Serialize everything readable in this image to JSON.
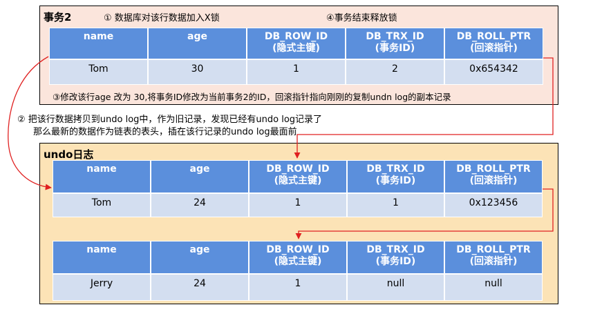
{
  "transaction": {
    "title": "事务2",
    "note_lock": "① 数据库对该行数据加入X锁",
    "note_release": "④事务结束释放锁",
    "note_modify": "③修改该行age 改为 30,将事务ID修改为当前事务2的ID，回滚指针指向刚刚的复制undn log的副本记录",
    "table": {
      "headers": [
        "name",
        "age",
        "DB_ROW_ID\n(隐式主键)",
        "DB_TRX_ID\n(事务ID)",
        "DB_ROLL_PTR\n(回滚指针)"
      ],
      "row": [
        "Tom",
        "30",
        "1",
        "2",
        "0x654342"
      ]
    }
  },
  "copy_note": {
    "line1": "② 把该行数据拷贝到undo log中，作为旧记录，发现已经有undo log记录了",
    "line2": "那么最新的数据作为链表的表头，插在该行记录的undo log最面前"
  },
  "undo_log": {
    "title": "undo日志",
    "record1": {
      "headers": [
        "name",
        "age",
        "DB_ROW_ID\n(隐式主键)",
        "DB_TRX_ID\n(事务ID)",
        "DB_ROLL_PTR\n(回滚指针)"
      ],
      "row": [
        "Tom",
        "24",
        "1",
        "1",
        "0x123456"
      ]
    },
    "record2": {
      "headers": [
        "name",
        "age",
        "DB_ROW_ID\n(隐式主键)",
        "DB_TRX_ID\n(事务ID)",
        "DB_ROLL_PTR\n(回滚指针)"
      ],
      "row": [
        "Jerry",
        "24",
        "1",
        "null",
        "null"
      ]
    }
  },
  "colors": {
    "header_bg": "#5b8fdc",
    "cell_bg": "#d3def0",
    "txn_bg": "#fbe5dc",
    "undo_bg": "#fce3b6",
    "arrow": "#e02020"
  }
}
